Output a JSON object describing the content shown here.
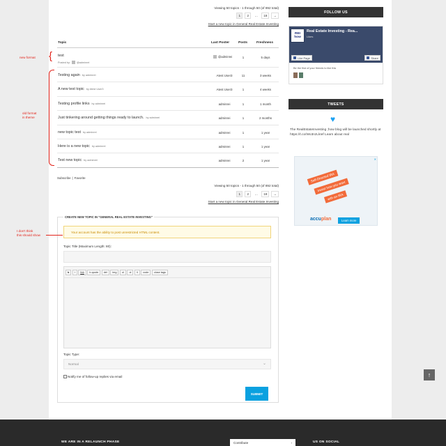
{
  "top": {
    "viewing": "Viewing 50 topics - 1 through 50 (of 892 total)",
    "pages": [
      "1",
      "2",
      "…",
      "18",
      "→"
    ],
    "start_link": "Start a new topic in General Real Estate Investing"
  },
  "table": {
    "headers": {
      "topic": "Topic",
      "last_poster": "Last Poster",
      "posts": "Posts",
      "freshness": "Freshness"
    },
    "first_row": {
      "title": "test",
      "posted_by_label": "Posted by:",
      "author": "@adminrei",
      "last_poster": "@adminrei",
      "posts": "1",
      "freshness": "5 days"
    },
    "rows": [
      {
        "title": "Testing again",
        "by": "by adminrei",
        "last_poster": "Atest User3",
        "posts": "11",
        "freshness": "3 weeks"
      },
      {
        "title": "A new test topic",
        "by": "by Atest User3",
        "last_poster": "Atest User3",
        "posts": "1",
        "freshness": "4 weeks"
      },
      {
        "title": "Testing profile links",
        "by": "by adminrei",
        "last_poster": "adminrei",
        "posts": "1",
        "freshness": "1 month"
      },
      {
        "title": "Just tinkering around getting things ready to launch.",
        "by": "by adminrei",
        "last_poster": "adminrei",
        "posts": "1",
        "freshness": "2 months"
      },
      {
        "title": "new topic test",
        "by": "by adminrei",
        "last_poster": "adminrei",
        "posts": "1",
        "freshness": "1 year"
      },
      {
        "title": "Here is a new topic",
        "by": "by adminrei",
        "last_poster": "adminrei",
        "posts": "1",
        "freshness": "1 year"
      },
      {
        "title": "Test new topic",
        "by": "by adminrei",
        "last_poster": "adminrei",
        "posts": "2",
        "freshness": "1 year"
      }
    ]
  },
  "subscribe": {
    "subscribe": "Subscribe",
    "sep": "|",
    "favorite": "Favorite"
  },
  "annotations": {
    "new_format": "new format",
    "old_format_1": "old format",
    "old_format_2": "in theme",
    "dont_show_1": "I don't think",
    "dont_show_2": "this should show"
  },
  "form": {
    "legend": "CREATE NEW TOPIC IN \"GENERAL REAL ESTATE INVESTING\"",
    "notice": "Your account has the ability to post unrestricted HTML content.",
    "title_label": "Topic Title (Maximum Length: 80):",
    "quicktags": [
      "b",
      "i",
      "link",
      "b-quote",
      "del",
      "img",
      "ul",
      "ol",
      "li",
      "code",
      "close tags"
    ],
    "type_label": "Topic Type:",
    "type_value": "Normal",
    "notify_label": "Notify me of follow-up replies via email",
    "submit": "SUBMIT"
  },
  "sidebar": {
    "follow_us": "FOLLOW US",
    "fb_logo": "REI how",
    "fb_title": "Real Estate Investing - Rea...",
    "fb_likes": "Likes",
    "fb_like_page": "Like Page",
    "fb_share": "Share",
    "fb_first": "Be the first of your friends to like this",
    "tweets": "TWEETS",
    "tweet_text": "The RealEstateInvesting ;how blog will be launched shortly at https://t.co/Wo3nzLkIef Learn about real",
    "ad_line1": "Self-Directed IRA",
    "ad_line2": "Invest how you want",
    "ad_line3": "with an IRA",
    "ad_brand_a": "accu",
    "ad_brand_b": "plan",
    "ad_learn": "Learn more"
  },
  "footer": {
    "col1": "WE ARE IN A RELAUNCH PHASE",
    "col2": "Contribute",
    "col2_arrow": "›",
    "col3": "US ON SOCIAL"
  },
  "scroll_top": "↑",
  "colors": {
    "accent": "#0aa1e0",
    "annotation": "#e2231a",
    "dark": "#333333",
    "footer": "#2a2a2a"
  }
}
